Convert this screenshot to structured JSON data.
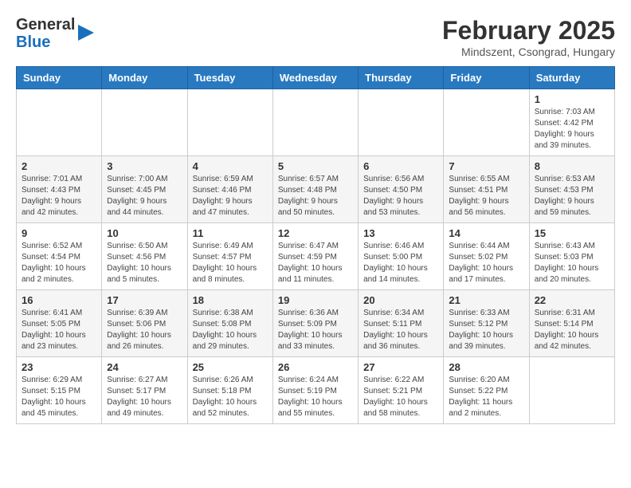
{
  "header": {
    "logo_general": "General",
    "logo_blue": "Blue",
    "month_title": "February 2025",
    "location": "Mindszent, Csongrad, Hungary"
  },
  "weekdays": [
    "Sunday",
    "Monday",
    "Tuesday",
    "Wednesday",
    "Thursday",
    "Friday",
    "Saturday"
  ],
  "weeks": [
    [
      {
        "day": "",
        "info": ""
      },
      {
        "day": "",
        "info": ""
      },
      {
        "day": "",
        "info": ""
      },
      {
        "day": "",
        "info": ""
      },
      {
        "day": "",
        "info": ""
      },
      {
        "day": "",
        "info": ""
      },
      {
        "day": "1",
        "info": "Sunrise: 7:03 AM\nSunset: 4:42 PM\nDaylight: 9 hours\nand 39 minutes."
      }
    ],
    [
      {
        "day": "2",
        "info": "Sunrise: 7:01 AM\nSunset: 4:43 PM\nDaylight: 9 hours\nand 42 minutes."
      },
      {
        "day": "3",
        "info": "Sunrise: 7:00 AM\nSunset: 4:45 PM\nDaylight: 9 hours\nand 44 minutes."
      },
      {
        "day": "4",
        "info": "Sunrise: 6:59 AM\nSunset: 4:46 PM\nDaylight: 9 hours\nand 47 minutes."
      },
      {
        "day": "5",
        "info": "Sunrise: 6:57 AM\nSunset: 4:48 PM\nDaylight: 9 hours\nand 50 minutes."
      },
      {
        "day": "6",
        "info": "Sunrise: 6:56 AM\nSunset: 4:50 PM\nDaylight: 9 hours\nand 53 minutes."
      },
      {
        "day": "7",
        "info": "Sunrise: 6:55 AM\nSunset: 4:51 PM\nDaylight: 9 hours\nand 56 minutes."
      },
      {
        "day": "8",
        "info": "Sunrise: 6:53 AM\nSunset: 4:53 PM\nDaylight: 9 hours\nand 59 minutes."
      }
    ],
    [
      {
        "day": "9",
        "info": "Sunrise: 6:52 AM\nSunset: 4:54 PM\nDaylight: 10 hours\nand 2 minutes."
      },
      {
        "day": "10",
        "info": "Sunrise: 6:50 AM\nSunset: 4:56 PM\nDaylight: 10 hours\nand 5 minutes."
      },
      {
        "day": "11",
        "info": "Sunrise: 6:49 AM\nSunset: 4:57 PM\nDaylight: 10 hours\nand 8 minutes."
      },
      {
        "day": "12",
        "info": "Sunrise: 6:47 AM\nSunset: 4:59 PM\nDaylight: 10 hours\nand 11 minutes."
      },
      {
        "day": "13",
        "info": "Sunrise: 6:46 AM\nSunset: 5:00 PM\nDaylight: 10 hours\nand 14 minutes."
      },
      {
        "day": "14",
        "info": "Sunrise: 6:44 AM\nSunset: 5:02 PM\nDaylight: 10 hours\nand 17 minutes."
      },
      {
        "day": "15",
        "info": "Sunrise: 6:43 AM\nSunset: 5:03 PM\nDaylight: 10 hours\nand 20 minutes."
      }
    ],
    [
      {
        "day": "16",
        "info": "Sunrise: 6:41 AM\nSunset: 5:05 PM\nDaylight: 10 hours\nand 23 minutes."
      },
      {
        "day": "17",
        "info": "Sunrise: 6:39 AM\nSunset: 5:06 PM\nDaylight: 10 hours\nand 26 minutes."
      },
      {
        "day": "18",
        "info": "Sunrise: 6:38 AM\nSunset: 5:08 PM\nDaylight: 10 hours\nand 29 minutes."
      },
      {
        "day": "19",
        "info": "Sunrise: 6:36 AM\nSunset: 5:09 PM\nDaylight: 10 hours\nand 33 minutes."
      },
      {
        "day": "20",
        "info": "Sunrise: 6:34 AM\nSunset: 5:11 PM\nDaylight: 10 hours\nand 36 minutes."
      },
      {
        "day": "21",
        "info": "Sunrise: 6:33 AM\nSunset: 5:12 PM\nDaylight: 10 hours\nand 39 minutes."
      },
      {
        "day": "22",
        "info": "Sunrise: 6:31 AM\nSunset: 5:14 PM\nDaylight: 10 hours\nand 42 minutes."
      }
    ],
    [
      {
        "day": "23",
        "info": "Sunrise: 6:29 AM\nSunset: 5:15 PM\nDaylight: 10 hours\nand 45 minutes."
      },
      {
        "day": "24",
        "info": "Sunrise: 6:27 AM\nSunset: 5:17 PM\nDaylight: 10 hours\nand 49 minutes."
      },
      {
        "day": "25",
        "info": "Sunrise: 6:26 AM\nSunset: 5:18 PM\nDaylight: 10 hours\nand 52 minutes."
      },
      {
        "day": "26",
        "info": "Sunrise: 6:24 AM\nSunset: 5:19 PM\nDaylight: 10 hours\nand 55 minutes."
      },
      {
        "day": "27",
        "info": "Sunrise: 6:22 AM\nSunset: 5:21 PM\nDaylight: 10 hours\nand 58 minutes."
      },
      {
        "day": "28",
        "info": "Sunrise: 6:20 AM\nSunset: 5:22 PM\nDaylight: 11 hours\nand 2 minutes."
      },
      {
        "day": "",
        "info": ""
      }
    ]
  ]
}
